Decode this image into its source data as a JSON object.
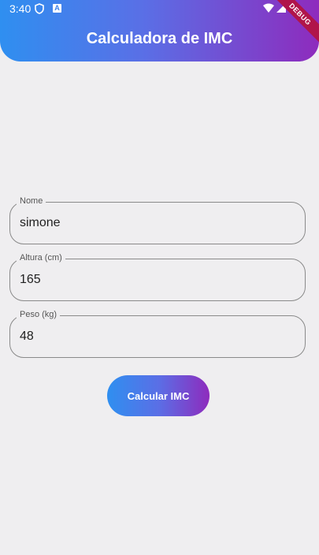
{
  "status": {
    "time": "3:40"
  },
  "appbar": {
    "title": "Calculadora de IMC",
    "debug_label": "DEBUG"
  },
  "form": {
    "nome": {
      "label": "Nome",
      "value": "simone"
    },
    "altura": {
      "label": "Altura (cm)",
      "value": "165"
    },
    "peso": {
      "label": "Peso (kg)",
      "value": "48"
    }
  },
  "button": {
    "label": "Calcular IMC"
  },
  "colors": {
    "gradient_start": "#2f8ff0",
    "gradient_end": "#8e2bbd",
    "background": "#efeef0"
  }
}
